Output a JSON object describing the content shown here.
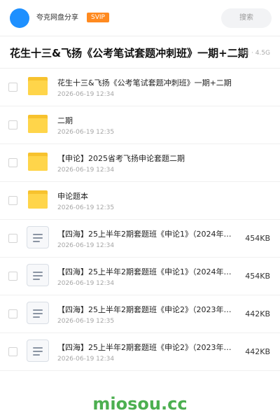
{
  "header": {
    "share_name": "夸克网盘分享",
    "badge": "SVIP",
    "search_label": "搜索"
  },
  "title_bar": {
    "title": "花生十三&飞扬《公考笔试套题冲刺班》一期+二期",
    "meta": "8项 · 4.5G"
  },
  "files": [
    {
      "type": "folder",
      "name": "花生十三&飞扬《公考笔试套题冲刺班》一期+二期",
      "date": "2026-06-19 12:34",
      "size": ""
    },
    {
      "type": "folder",
      "name": "二期",
      "date": "2026-06-19 12:35",
      "size": ""
    },
    {
      "type": "folder",
      "name": "【申论】2025省考飞扬申论套题二期",
      "date": "2026-06-19 12:34",
      "size": ""
    },
    {
      "type": "folder",
      "name": "申论题本",
      "date": "2026-06-19 12:35",
      "size": ""
    },
    {
      "type": "doc",
      "name": "【四海】25上半年2期套题班《申论1》（2024年…",
      "date": "2026-06-19 12:34",
      "size": "454KB"
    },
    {
      "type": "doc",
      "name": "【四海】25上半年2期套题班《申论1》（2024年…",
      "date": "2026-06-19 12:34",
      "size": "454KB"
    },
    {
      "type": "doc",
      "name": "【四海】25上半年2期套题班《申论2》（2023年…",
      "date": "2026-06-19 12:35",
      "size": "442KB"
    },
    {
      "type": "doc",
      "name": "【四海】25上半年2期套题班《申论2》（2023年…",
      "date": "2026-06-19 12:34",
      "size": "442KB"
    }
  ],
  "watermark": "miosou.cc",
  "colors": {
    "avatar": "#1e90ff",
    "svip_badge": "#ff8a1f",
    "folder": "#ffd54a",
    "watermark": "#4caf50"
  }
}
